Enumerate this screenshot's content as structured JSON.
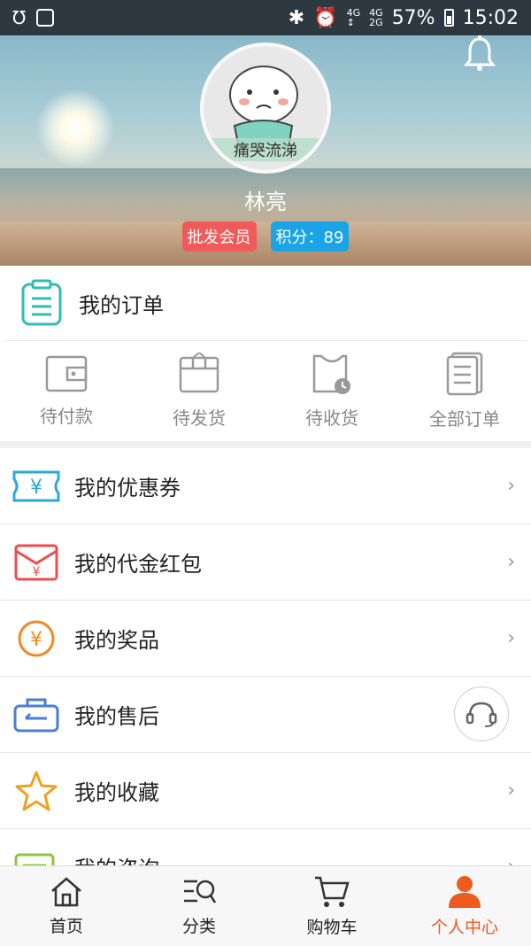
{
  "status_bar": {
    "battery": "57%",
    "time": "15:02",
    "network_a": "4G",
    "network_b_top": "4G",
    "network_b_bottom": "2G"
  },
  "profile": {
    "avatar_caption": "痛哭流涕",
    "username": "林亮",
    "member_badge": "批发会员",
    "points_badge": "积分：89"
  },
  "orders": {
    "title": "我的订单",
    "items": [
      {
        "label": "待付款",
        "icon": "wallet-icon"
      },
      {
        "label": "待发货",
        "icon": "package-icon"
      },
      {
        "label": "待收货",
        "icon": "bag-clock-icon"
      },
      {
        "label": "全部订单",
        "icon": "document-list-icon"
      }
    ]
  },
  "menu": {
    "items": [
      {
        "label": "我的优惠券",
        "icon": "coupon-icon"
      },
      {
        "label": "我的代金红包",
        "icon": "red-envelope-icon"
      },
      {
        "label": "我的奖品",
        "icon": "yen-coin-icon"
      },
      {
        "label": "我的售后",
        "icon": "after-sales-icon"
      },
      {
        "label": "我的收藏",
        "icon": "star-icon"
      },
      {
        "label": "我的咨询",
        "icon": "consult-icon"
      }
    ],
    "chevron": "›"
  },
  "bottom_nav": {
    "items": [
      {
        "label": "首页",
        "icon": "home-icon"
      },
      {
        "label": "分类",
        "icon": "category-search-icon"
      },
      {
        "label": "购物车",
        "icon": "cart-icon"
      },
      {
        "label": "个人中心",
        "icon": "person-icon"
      }
    ],
    "active_index": 3
  },
  "colors": {
    "accent": "#ef5a1e",
    "teal": "#2fbcb5",
    "badge_red": "#f05a5a",
    "badge_blue": "#1aa4e6"
  }
}
